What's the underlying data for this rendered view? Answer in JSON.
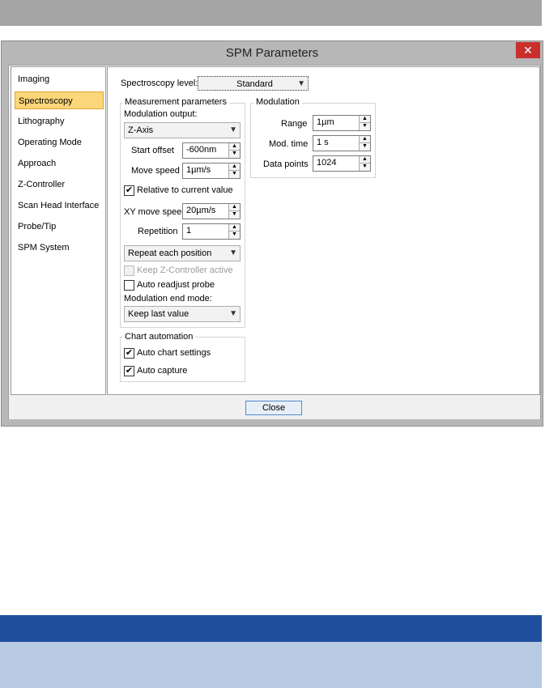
{
  "window": {
    "title": "SPM Parameters",
    "close_glyph": "✕"
  },
  "nav": {
    "items": [
      {
        "label": "Imaging"
      },
      {
        "label": "Spectroscopy",
        "selected": true
      },
      {
        "label": "Lithography"
      },
      {
        "label": "Operating Mode"
      },
      {
        "label": "Approach"
      },
      {
        "label": "Z-Controller"
      },
      {
        "label": "Scan Head Interface"
      },
      {
        "label": "Probe/Tip"
      },
      {
        "label": "SPM System"
      }
    ]
  },
  "spectroscopy_level": {
    "label": "Spectroscopy level:",
    "value": "Standard"
  },
  "measurement": {
    "legend": "Measurement parameters",
    "modulation_output_label": "Modulation output:",
    "modulation_output_value": "Z-Axis",
    "start_offset_label": "Start offset",
    "start_offset_value": "-600nm",
    "move_speed_label": "Move speed",
    "move_speed_value": "1µm/s",
    "relative_label": "Relative to current value",
    "relative_checked": true,
    "xy_move_speed_label": "XY move speed",
    "xy_move_speed_value": "20µm/s",
    "repetition_label": "Repetition",
    "repetition_value": "1",
    "repeat_mode_value": "Repeat each position",
    "keep_z_label": "Keep Z-Controller active",
    "keep_z_checked": false,
    "keep_z_disabled": true,
    "auto_readjust_label": "Auto readjust probe",
    "auto_readjust_checked": false,
    "end_mode_label": "Modulation end mode:",
    "end_mode_value": "Keep last value"
  },
  "chart_automation": {
    "legend": "Chart automation",
    "auto_chart_label": "Auto chart settings",
    "auto_chart_checked": true,
    "auto_capture_label": "Auto capture",
    "auto_capture_checked": true
  },
  "modulation": {
    "legend": "Modulation",
    "range_label": "Range",
    "range_value": "1µm",
    "mod_time_label": "Mod. time",
    "mod_time_value": "1 s",
    "data_points_label": "Data points",
    "data_points_value": "1024"
  },
  "footer": {
    "close_label": "Close"
  },
  "glyphs": {
    "check": "✔",
    "combo_arrow": "▼",
    "spin_up": "▲",
    "spin_down": "▼"
  }
}
